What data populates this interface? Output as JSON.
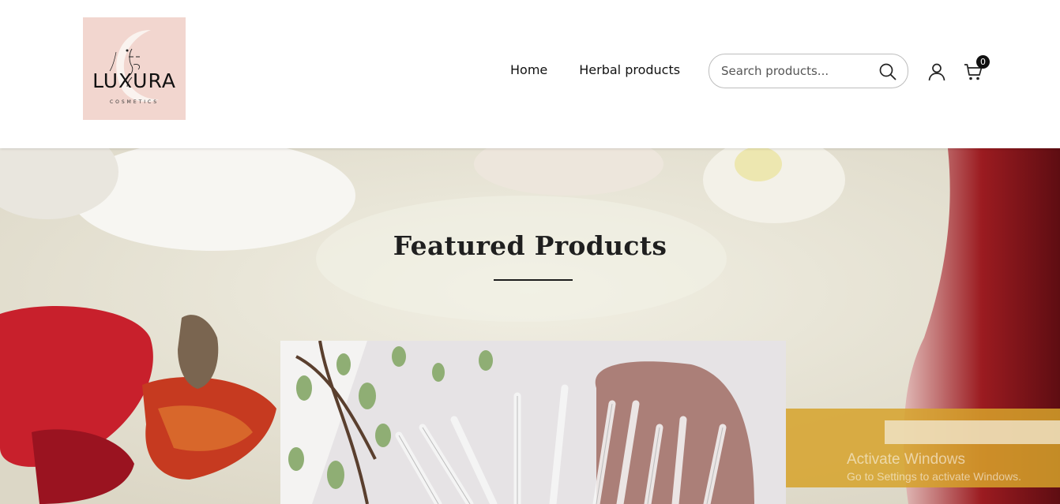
{
  "logo": {
    "word": "LUXURA",
    "sub": "COSMETICS"
  },
  "nav": {
    "items": [
      {
        "label": "Home"
      },
      {
        "label": "Herbal products"
      }
    ]
  },
  "search": {
    "placeholder": "Search products..."
  },
  "cart": {
    "count": "0"
  },
  "hero": {
    "title": "Featured Products"
  },
  "watermark": {
    "line1": "Activate Windows",
    "line2": "Go to Settings to activate Windows."
  },
  "colors": {
    "logo_bg": "#f2d6cf",
    "text": "#111111",
    "petal_red": "#c8202c"
  },
  "icons": [
    "search-icon",
    "user-icon",
    "cart-icon"
  ]
}
